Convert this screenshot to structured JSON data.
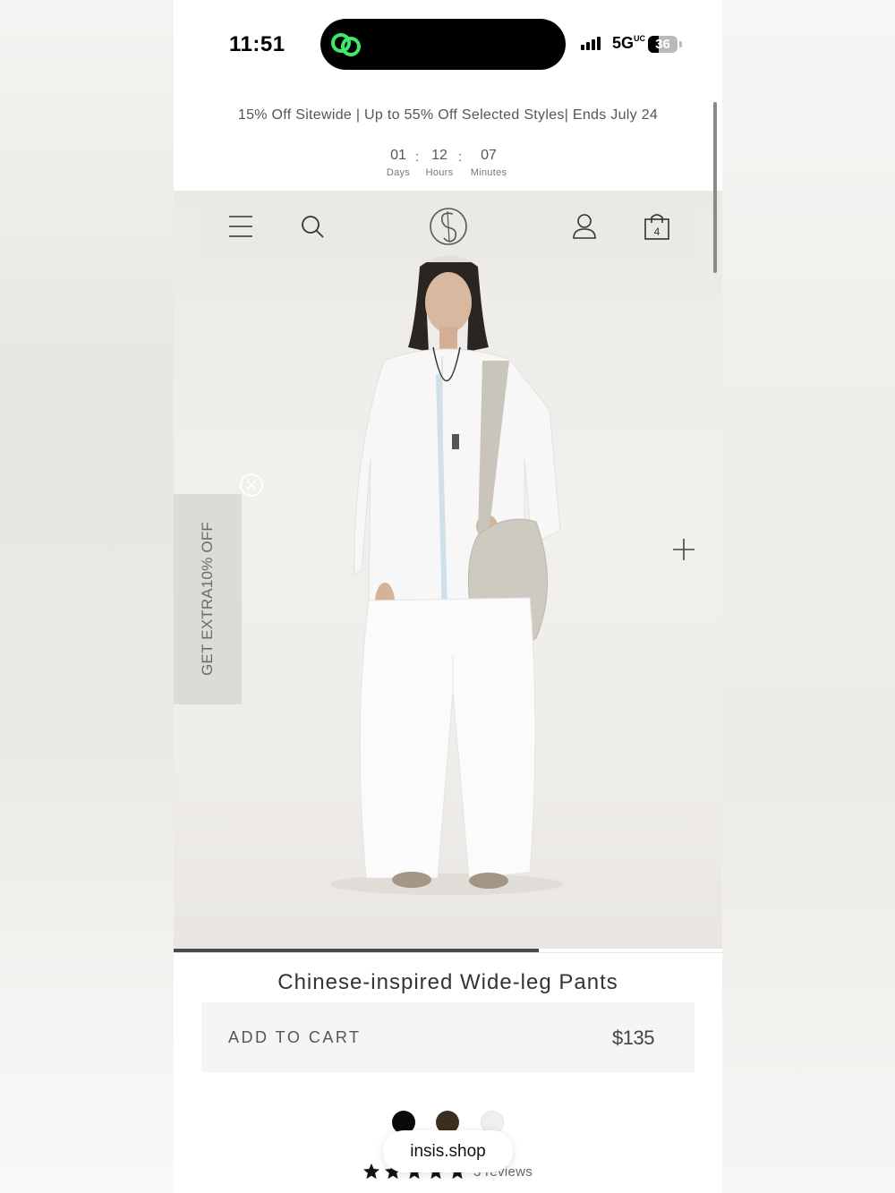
{
  "status_bar": {
    "time": "11:51",
    "network": "5G",
    "network_suffix": "UC",
    "battery": "36",
    "battery_level": 0.36
  },
  "promo": {
    "text": "15% Off Sitewide | Up to 55% Off Selected Styles| Ends July 24",
    "countdown": [
      {
        "value": "01",
        "label": "Days"
      },
      {
        "value": "12",
        "label": "Hours"
      },
      {
        "value": "07",
        "label": "Minutes"
      }
    ],
    "separator": ":"
  },
  "nav": {
    "icons": [
      "menu-icon",
      "search-icon",
      "brand-logo",
      "account-icon",
      "cart-bag-icon"
    ],
    "cart_count": "4"
  },
  "hero": {
    "side_tab_label": "GET EXTRA10% OFF",
    "gallery_progress": 0.665
  },
  "product": {
    "title": "Chinese-inspired Wide-leg Pants",
    "add_to_cart_label": "ADD TO CART",
    "price": "$135",
    "swatches": [
      "#0a0a0a",
      "#3b2e1e",
      "#efefed"
    ],
    "rating_stars": 5,
    "reviews_text": "3 reviews"
  },
  "browser": {
    "url": "insis.shop"
  },
  "colors": {
    "accent_green": "#3ee86a",
    "text_gray": "#555555"
  }
}
